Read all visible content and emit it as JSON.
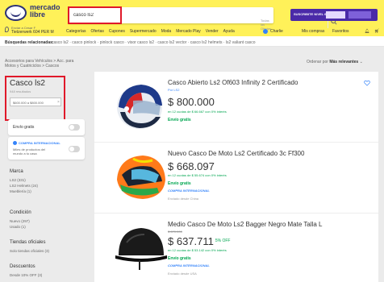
{
  "header": {
    "logo_line1": "mercado",
    "logo_line2": "libre",
    "search_value": "casco ls2",
    "search_category": "Todas las Ofertas",
    "promo": "SUSCRIBITE NIVEL 6",
    "location_line1": "Enviar a Cesar F",
    "location_line2": "Tietzerwerk 604 PER M",
    "nav": [
      "Categorías",
      "Ofertas",
      "Cupones",
      "Supermercado",
      "Moda",
      "Mercado Play",
      "Vender",
      "Ayuda"
    ],
    "user_name": "Charlie",
    "my_purchases": "Mis compras",
    "favorites": "Favoritos"
  },
  "related": {
    "label": "Búsquedas relacionadas:",
    "items": "casco ls2 · casco pinlock · pinlock casco · visor casco ls2 · casco ls2 vector · casco ls2 helmets · ls2 valiant casco"
  },
  "breadcrumb": {
    "line1": "Accesorios para Vehículos > Acc. para",
    "line2": "Motos y Cuatriciclos > Cascos"
  },
  "sort": {
    "label": "Ordenar por",
    "value": "Más relevantes"
  },
  "filters": {
    "title": "Casco ls2",
    "count": "948 resultados",
    "chip": "$600.000 a $800.000",
    "free_shipping": "Envío gratis",
    "intl_title": "COMPRA INTERNACIONAL",
    "intl_desc": "Miles de productos del mundo a tu casa",
    "marca_title": "Marca",
    "marca_items": [
      "LS2 (331)",
      "LS2 Helmets (24)",
      "Mueblería (1)"
    ],
    "condicion_title": "Condición",
    "condicion_items": [
      "Nuevo (297)",
      "Usado (1)"
    ],
    "tiendas_title": "Tiendas oficiales",
    "tiendas_items": [
      "Solo tiendas oficiales (3)"
    ],
    "descuentos_title": "Descuentos",
    "descuentos_items": [
      "Desde 10% OFF (3)"
    ]
  },
  "results": [
    {
      "title": "Casco Abierto Ls2 Of603 Infinity 2 Certificado",
      "seller": "Por LS2",
      "price": "$ 800.000",
      "installments": "en 12 cuotas de $ 66.667 con 0% interés",
      "shipping": "Envío gratis"
    },
    {
      "title": "Nuevo Casco De Moto Ls2 Certificado 3c Ff300",
      "price": "$ 668.097",
      "installments": "en 12 cuotas de $ 55.674 con 0% interés",
      "shipping": "Envío gratis",
      "intl": "COMPRA INTERNACIONAL",
      "extra": "Enviado desde China"
    },
    {
      "title": "Medio Casco De Moto Ls2 Bagger Negro Mate Talla L",
      "old_price": "$ 670.000",
      "price": "$ 637.711",
      "discount": "5% OFF",
      "installments": "en 12 cuotas de $ 53.142 con 0% interés",
      "shipping": "Envío gratis",
      "intl": "COMPRA INTERNACIONAL",
      "extra": "Enviado desde USA"
    }
  ],
  "colors": {
    "header_bg": "#fff159",
    "accent": "#3483fa",
    "green": "#00a650",
    "highlight": "#e0192a"
  }
}
